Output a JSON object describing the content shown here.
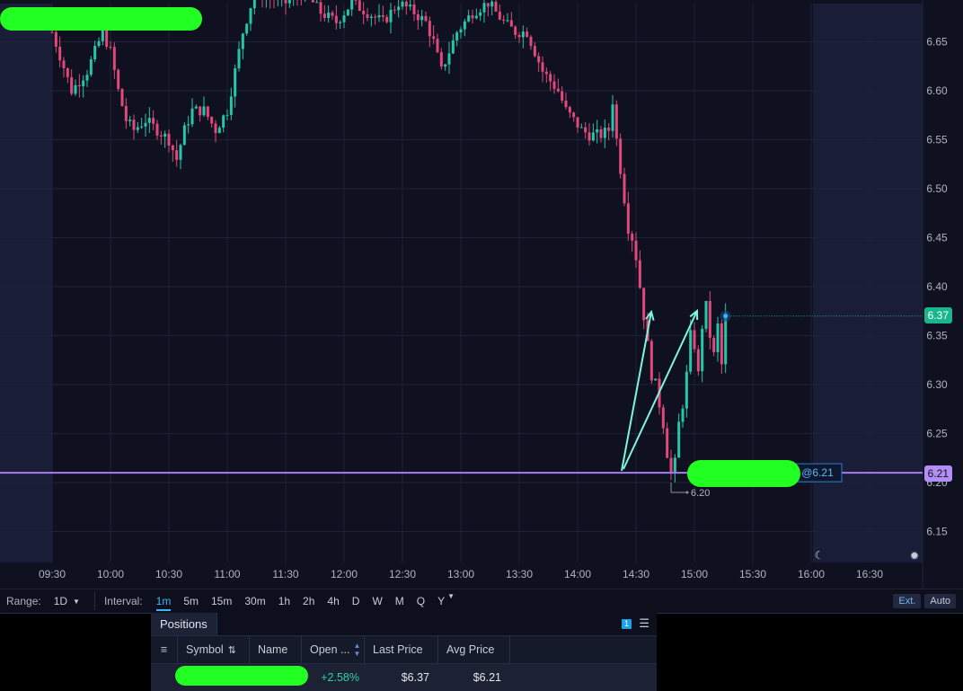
{
  "chart": {
    "y_ticks": [
      "6.65",
      "6.60",
      "6.55",
      "6.50",
      "6.45",
      "6.40",
      "6.35",
      "6.30",
      "6.25",
      "6.20",
      "6.15"
    ],
    "x_ticks": [
      "09:30",
      "10:00",
      "10:30",
      "11:00",
      "11:30",
      "12:00",
      "12:30",
      "13:00",
      "13:30",
      "14:00",
      "14:30",
      "15:00",
      "15:30",
      "16:00",
      "16:30"
    ],
    "last_price": "6.37",
    "position_price": "6.21",
    "position_label": "@6.21",
    "low_marker": "6.20",
    "colors": {
      "up": "#26c6a8",
      "down": "#e0497a",
      "position_line": "#a57cf2",
      "last_price_bg": "#19b58c",
      "arrow": "#7ff5e0",
      "background": "#0f1120",
      "extended_hours_bg": "#1a1d37"
    },
    "icons": [
      "moon-icon",
      "sun-icon"
    ]
  },
  "toolbar": {
    "range_label": "Range:",
    "range_value": "1D",
    "interval_label": "Interval:",
    "intervals": [
      "1m",
      "5m",
      "15m",
      "30m",
      "1h",
      "2h",
      "4h",
      "D",
      "W",
      "M",
      "Q",
      "Y"
    ],
    "active_interval": "1m",
    "ext_label": "Ext.",
    "auto_label": "Auto"
  },
  "positions": {
    "tab_label": "Positions",
    "badge_count": "1",
    "columns": [
      "Symbol",
      "Name",
      "Open ...",
      "Last Price",
      "Avg Price"
    ],
    "rows": [
      {
        "open_pl": "+2.58%",
        "last_price": "$6.37",
        "avg_price": "$6.21"
      }
    ]
  }
}
